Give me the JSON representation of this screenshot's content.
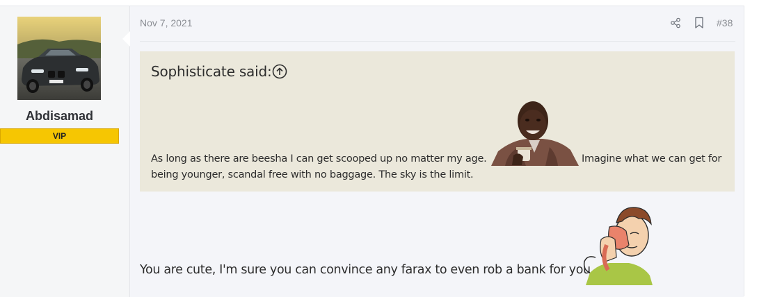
{
  "user": {
    "avatar_icon": "car-avatar-icon",
    "username": "Abdisamad",
    "badge": "VIP",
    "badge_color": "#f6c602"
  },
  "post": {
    "date": "Nov 7, 2021",
    "number": "#38",
    "share_icon": "share-icon",
    "bookmark_icon": "bookmark-icon"
  },
  "quote": {
    "author_label": "Sophisticate said:",
    "jump_icon": "arrow-up-circle-icon",
    "line1_before_image": "As long as there are beesha I can get scooped up no matter my age.",
    "image_icon": "laughing-man-emoji-icon",
    "line1_after_image": "Imagine what we can get for",
    "line2": "being younger, scandal free with no baggage. The sky is the limit.",
    "background_color": "#ebe8db"
  },
  "reply": {
    "text": "You are cute, I'm sure you can convince any farax to even rob a bank for you",
    "image_icon": "sweating-man-emoji-icon"
  }
}
